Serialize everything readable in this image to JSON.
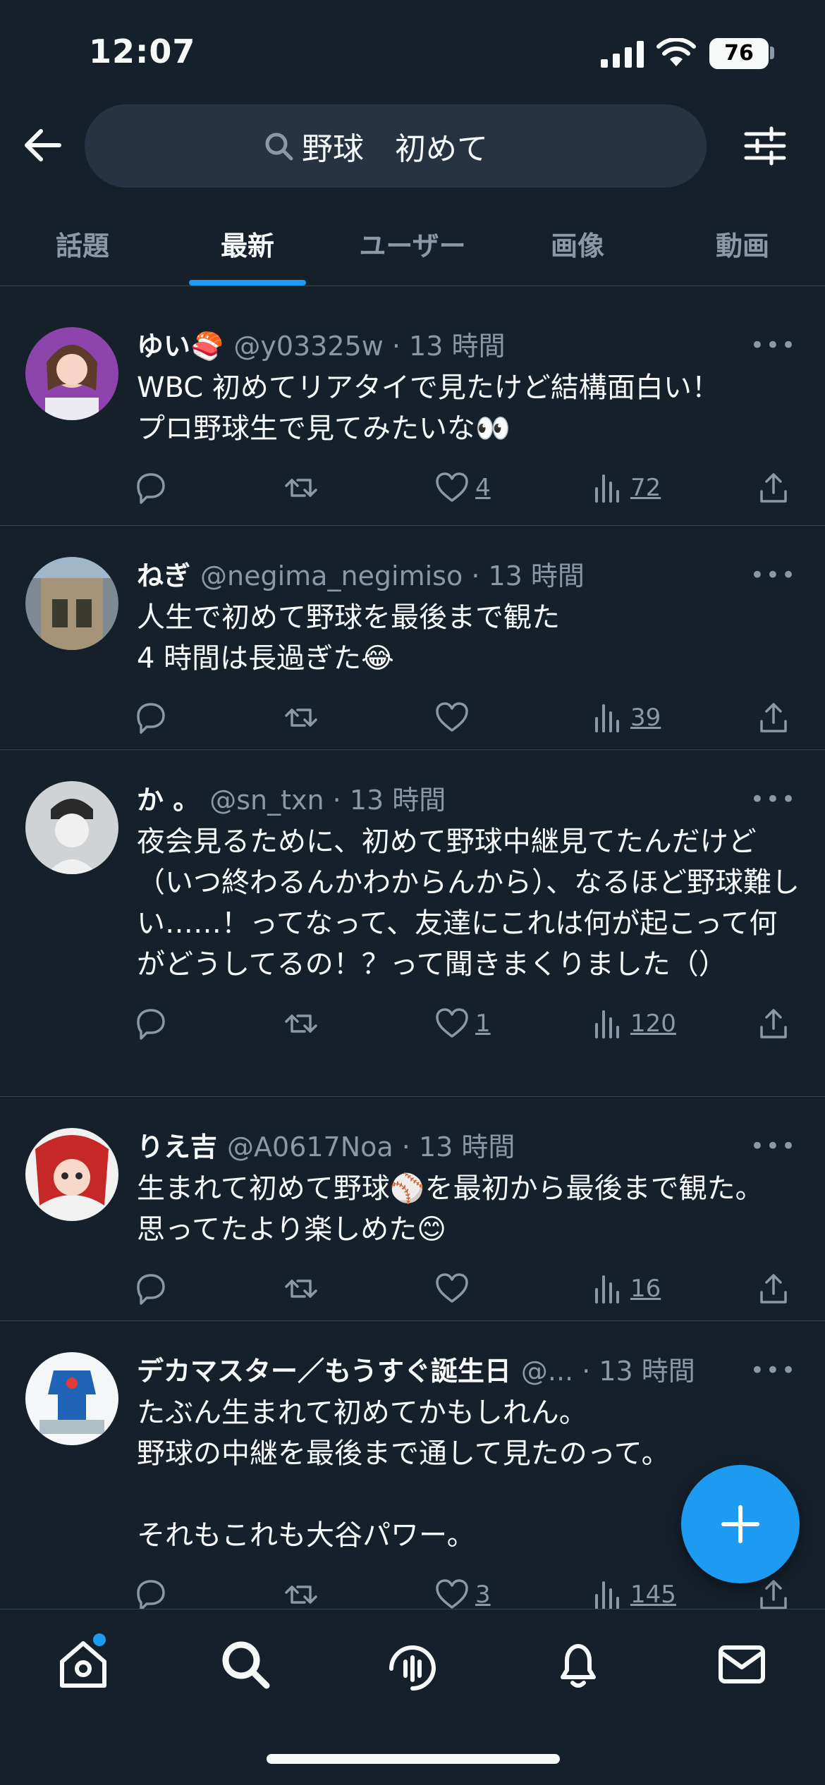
{
  "status": {
    "time": "12:07",
    "battery": "76"
  },
  "search": {
    "value": "野球　初めて"
  },
  "tabs": [
    "話題",
    "最新",
    "ユーザー",
    "画像",
    "動画"
  ],
  "tweets": [
    {
      "name": "ゆい🍣",
      "handle": "@y03325w",
      "time": "13 時間",
      "text": "WBC 初めてリアタイで見たけど結構面白い！\nプロ野球生で見てみたいな👀",
      "likes": "4",
      "views": "72",
      "avatar_color": "#7e57c2"
    },
    {
      "name": "ねぎ",
      "handle": "@negima_negimiso",
      "time": "13 時間",
      "text": "人生で初めて野球を最後まで観た\n4 時間は長過ぎた😂",
      "likes": "",
      "views": "39",
      "avatar_color": "#5d6b73"
    },
    {
      "name": "か 。",
      "handle": "@sn_txn",
      "time": "13 時間",
      "text": "夜会見るために、初めて野球中継見てたんだけど（いつ終わるんかわからんから）、なるほど野球難しい……！ってなって、友達にこれは何が起こって何がどうしてるの！？って聞きまくりました（）",
      "likes": "1",
      "views": "120",
      "avatar_color": "#d0d3d6"
    },
    {
      "name": "りえ吉",
      "handle": "@A0617Noa",
      "time": "13 時間",
      "text": "生まれて初めて野球⚾を最初から最後まで観た。\n思ってたより楽しめた😊",
      "likes": "",
      "views": "16",
      "avatar_color": "#c62828"
    },
    {
      "name": "デカマスター／もうすぐ誕生日",
      "handle": "@...",
      "time": "13 時間",
      "text": "たぶん生まれて初めてかもしれん。\n野球の中継を最後まで通して見たのって。\n\nそれもこれも大谷パワー。",
      "likes": "3",
      "views": "145",
      "avatar_color": "#e0e6ea"
    }
  ],
  "icons": [
    "back-arrow-icon",
    "search-icon",
    "filter-icon",
    "reply-icon",
    "retweet-icon",
    "like-icon",
    "views-icon",
    "share-icon",
    "more-icon",
    "compose-icon",
    "home-icon",
    "spaces-icon",
    "bell-icon",
    "mail-icon"
  ],
  "colors": {
    "accent": "#1d9bf0",
    "background": "#15202b",
    "muted": "#8b98a5"
  }
}
